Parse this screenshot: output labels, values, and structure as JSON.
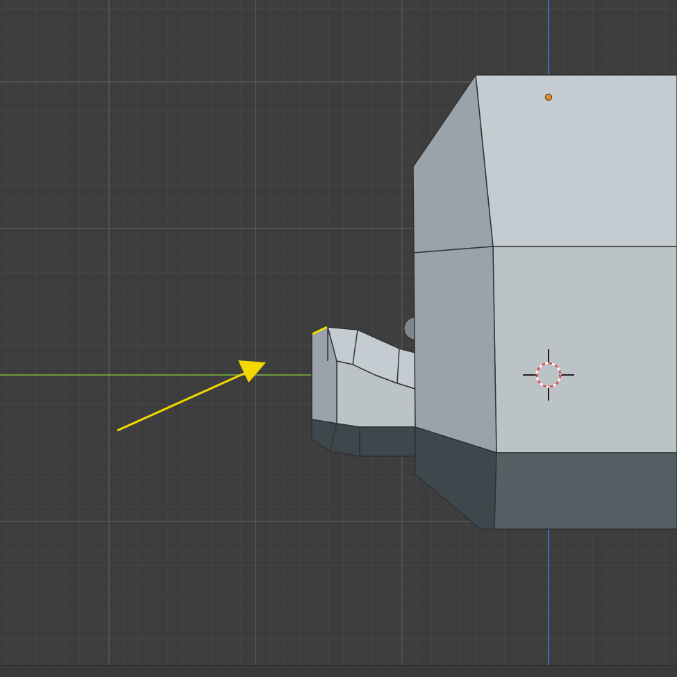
{
  "app": {
    "area": "3D Viewport",
    "view": "orthographic"
  },
  "colors": {
    "background": "#3d3d3d",
    "grid_minor": "#464646",
    "grid_major": "#525252",
    "axis_x": "#6e9a3a",
    "axis_z": "#3c6ec9",
    "annotation": "#f5d800",
    "cursor_red": "#e04040",
    "cursor_white": "#ffffff",
    "origin_dot": "#e8901e",
    "mesh_top": "#c5ccd1",
    "mesh_side": "#9aa3a9",
    "mesh_front": "#bcc3c7",
    "mesh_dark": "#3d474c",
    "mesh_bottom": "#566064"
  },
  "icons": {
    "cursor": "3d-cursor-icon",
    "origin": "origin-dot-icon",
    "annotation": "arrow-annotation-icon"
  }
}
